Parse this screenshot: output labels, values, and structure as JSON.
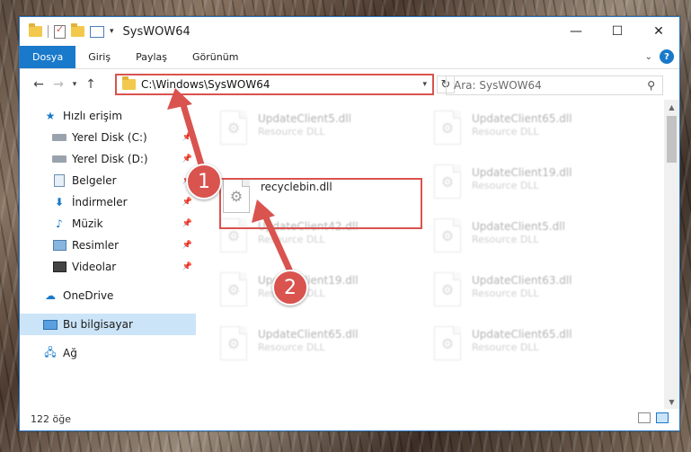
{
  "window": {
    "title": "SysWOW64",
    "controls": {
      "minimize": "—",
      "maximize": "☐",
      "close": "✕"
    }
  },
  "ribbon": {
    "tabs": [
      "Dosya",
      "Giriş",
      "Paylaş",
      "Görünüm"
    ],
    "help": "?"
  },
  "navbar": {
    "address": "C:\\Windows\\SysWOW64",
    "search_placeholder": "Ara: SysWOW64"
  },
  "sidebar": {
    "items": [
      {
        "label": "Hızlı erişim",
        "icon": "star-icon"
      },
      {
        "label": "Yerel Disk (C:)",
        "icon": "disk-icon",
        "pinned": true
      },
      {
        "label": "Yerel Disk (D:)",
        "icon": "disk-icon",
        "pinned": true
      },
      {
        "label": "Belgeler",
        "icon": "documents-icon",
        "pinned": true
      },
      {
        "label": "İndirmeler",
        "icon": "download-icon",
        "pinned": true
      },
      {
        "label": "Müzik",
        "icon": "music-icon",
        "pinned": true
      },
      {
        "label": "Resimler",
        "icon": "pictures-icon",
        "pinned": true
      },
      {
        "label": "Videolar",
        "icon": "videos-icon",
        "pinned": true
      },
      {
        "label": "OneDrive",
        "icon": "cloud-icon"
      },
      {
        "label": "Bu bilgisayar",
        "icon": "computer-icon",
        "selected": true
      },
      {
        "label": "Ağ",
        "icon": "network-icon"
      }
    ]
  },
  "files": {
    "items": [
      {
        "name": "UpdateClient5.dll",
        "type": "Resource DLL"
      },
      {
        "name": "UpdateClient65.dll",
        "type": "Resource DLL"
      },
      {
        "name": "recyclebin.dll",
        "type": ""
      },
      {
        "name": "UpdateClient19.dll",
        "type": "Resource DLL"
      },
      {
        "name": "UpdateClient42.dll",
        "type": "Resource DLL"
      },
      {
        "name": "UpdateClient5.dll",
        "type": "Resource DLL"
      },
      {
        "name": "UpdateClient19.dll",
        "type": "Resource DLL"
      },
      {
        "name": "UpdateClient63.dll",
        "type": "Resource DLL"
      },
      {
        "name": "UpdateClient65.dll",
        "type": "Resource DLL"
      },
      {
        "name": "UpdateClient65.dll",
        "type": "Resource DLL"
      }
    ]
  },
  "status": {
    "count": "122 öğe"
  },
  "annotations": {
    "step1": "1",
    "step2": "2"
  },
  "colors": {
    "accent": "#1979ca",
    "annotation": "#d9534f"
  }
}
